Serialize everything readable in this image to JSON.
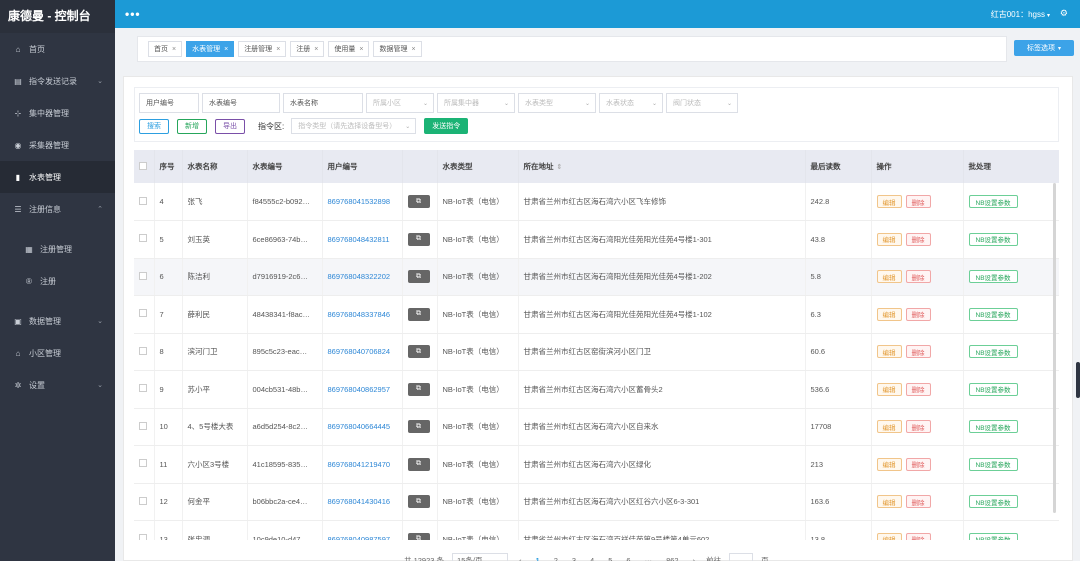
{
  "app": {
    "title": "康德曼 - 控制台"
  },
  "sidebar": {
    "items": [
      {
        "label": "首页",
        "icon": "home-icon",
        "glyph": "⌂",
        "chevron": ""
      },
      {
        "label": "指令发送记录",
        "icon": "list-icon",
        "glyph": "▤",
        "chevron": "⌄"
      },
      {
        "label": "集中器管理",
        "icon": "sitemap-icon",
        "glyph": "⊹",
        "chevron": ""
      },
      {
        "label": "采集器管理",
        "icon": "pin-icon",
        "glyph": "◉",
        "chevron": ""
      },
      {
        "label": "水表管理",
        "icon": "database-icon",
        "glyph": "▮",
        "chevron": ""
      },
      {
        "label": "注册信息",
        "icon": "menu-icon",
        "glyph": "☰",
        "chevron": "⌃"
      },
      {
        "label": "注册管理",
        "icon": "grid-icon",
        "glyph": "▦",
        "chevron": ""
      },
      {
        "label": "注册",
        "icon": "registered-icon",
        "glyph": "®",
        "chevron": ""
      },
      {
        "label": "数据管理",
        "icon": "box-icon",
        "glyph": "▣",
        "chevron": "⌄"
      },
      {
        "label": "小区管理",
        "icon": "bank-icon",
        "glyph": "⌂",
        "chevron": ""
      },
      {
        "label": "设置",
        "icon": "gear-icon",
        "glyph": "✲",
        "chevron": "⌄"
      }
    ]
  },
  "topbar": {
    "menu_dots": "•••",
    "user": "红古001：hgss",
    "caret": "▾",
    "cogs": "⚙"
  },
  "tags": {
    "items": [
      "首页",
      "水表管理",
      "注册管理",
      "注册",
      "使用量",
      "数据管理"
    ],
    "close": "×",
    "options_label": "标签选项",
    "options_caret": "▾"
  },
  "filters": {
    "row1": [
      {
        "text": "用户编号",
        "dim": false,
        "caret": ""
      },
      {
        "text": "水表编号",
        "dim": false,
        "caret": ""
      },
      {
        "text": "水表名称",
        "dim": false,
        "caret": ""
      },
      {
        "text": "所属小区",
        "dim": true,
        "caret": "⌄"
      },
      {
        "text": "所属集中器",
        "dim": true,
        "caret": "⌄"
      },
      {
        "text": "水表类型",
        "dim": true,
        "caret": "⌄"
      },
      {
        "text": "水表状态",
        "dim": true,
        "caret": "⌄"
      },
      {
        "text": "阀门状态",
        "dim": true,
        "caret": "⌄"
      }
    ],
    "search": "搜索",
    "add": "新增",
    "export": "导出",
    "command_label": "指令区:",
    "command_placeholder": "指令类型（请先选择设备型号）",
    "send": "发送指令"
  },
  "table": {
    "headers": [
      "序号",
      "水表名称",
      "水表编号",
      "用户编号",
      "水表类型",
      "所在地址",
      "最后读数",
      "操作",
      "批处理"
    ],
    "sort_icon": "⇕",
    "copy_glyph": "⧉",
    "edit_label": "编辑",
    "delete_label": "删除",
    "nb_label": "NB设置参数",
    "rows": [
      {
        "no": "4",
        "name": "张飞",
        "meter": "f84555c2-b092…",
        "user": "869768041532898",
        "type": "NB-IoT表（电信）",
        "address": "甘肃省兰州市红古区海石湾六小区飞车修饰",
        "reading": "242.8"
      },
      {
        "no": "5",
        "name": "刘玉英",
        "meter": "6ce86963-74b…",
        "user": "869768048432811",
        "type": "NB-IoT表（电信）",
        "address": "甘肃省兰州市红古区海石湾阳光佳苑阳光佳苑4号楼1-301",
        "reading": "43.8"
      },
      {
        "no": "6",
        "name": "陈洁利",
        "meter": "d7916919-2c6…",
        "user": "869768048322202",
        "type": "NB-IoT表（电信）",
        "address": "甘肃省兰州市红古区海石湾阳光佳苑阳光佳苑4号楼1-202",
        "reading": "5.8"
      },
      {
        "no": "7",
        "name": "薛利民",
        "meter": "48438341-f8ac…",
        "user": "869768048337846",
        "type": "NB-IoT表（电信）",
        "address": "甘肃省兰州市红古区海石湾阳光佳苑阳光佳苑4号楼1-102",
        "reading": "6.3"
      },
      {
        "no": "8",
        "name": "滨河门卫",
        "meter": "895c5c23-eac…",
        "user": "869768040706824",
        "type": "NB-IoT表（电信）",
        "address": "甘肃省兰州市红古区窑街滨河小区门卫",
        "reading": "60.6"
      },
      {
        "no": "9",
        "name": "苏小平",
        "meter": "004cb531-48b…",
        "user": "869768040862957",
        "type": "NB-IoT表（电信）",
        "address": "甘肃省兰州市红古区海石湾六小区蓄骨头2",
        "reading": "536.6"
      },
      {
        "no": "10",
        "name": "4、5号楼大表",
        "meter": "a6d5d254-8c2…",
        "user": "869768040664445",
        "type": "NB-IoT表（电信）",
        "address": "甘肃省兰州市红古区海石湾六小区自来水",
        "reading": "17708"
      },
      {
        "no": "11",
        "name": "六小区3号楼",
        "meter": "41c18595-835…",
        "user": "869768041219470",
        "type": "NB-IoT表（电信）",
        "address": "甘肃省兰州市红古区海石湾六小区绿化",
        "reading": "213"
      },
      {
        "no": "12",
        "name": "何金平",
        "meter": "b06bbc2a-ce4…",
        "user": "869768041430416",
        "type": "NB-IoT表（电信）",
        "address": "甘肃省兰州市红古区海石湾六小区红谷六小区6-3-301",
        "reading": "163.6"
      },
      {
        "no": "13",
        "name": "张忠调",
        "meter": "10c9de10-d47…",
        "user": "869768040987597",
        "type": "NB-IoT表（电信）",
        "address": "甘肃省兰州市红古区海石湾百祥佳苑第9号楼第4单元602",
        "reading": "13.8"
      }
    ]
  },
  "pager": {
    "total": "共 12923 条",
    "size": "15条/页",
    "prev": "‹",
    "pages": [
      "1",
      "2",
      "3",
      "4",
      "5",
      "6",
      "···",
      "862"
    ],
    "next": "›",
    "goto_label": "前往",
    "goto_unit": "页"
  },
  "colors": {
    "topbar": "#1c9ad6",
    "sidebar": "#2f3542",
    "accent": "#3ca3e8",
    "link": "#2d87d6",
    "green": "#1bb375"
  }
}
